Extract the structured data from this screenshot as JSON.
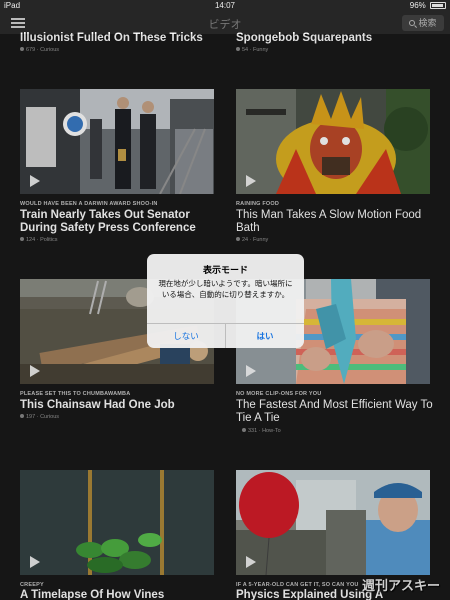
{
  "status_bar": {
    "device": "iPad",
    "time": "14:07",
    "battery": "96%"
  },
  "nav": {
    "title": "ビデオ",
    "search_label": "検索"
  },
  "top_row": [
    {
      "title": "Illusionist Fulled On These Tricks",
      "meta": "679 · Curious"
    },
    {
      "title": "Spongebob Squarepants",
      "meta": "54 · Funny"
    }
  ],
  "cards": [
    {
      "kicker": "WOULD HAVE BEEN A DARWIN AWARD SHOO-IN",
      "title": "Train Nearly Takes Out Senator During Safety Press Conference",
      "meta": "124 · Politics"
    },
    {
      "kicker": "RAINING FOOD",
      "title": "This Man Takes A Slow Motion Food Bath",
      "meta": "24 · Funny"
    },
    {
      "kicker": "PLEASE SET THIS TO CHUMBAWAMBA",
      "title": "This Chainsaw Had One Job",
      "meta": "197 · Curious"
    },
    {
      "kicker": "NO MORE CLIP-ONS FOR YOU",
      "title": "The Fastest And Most Efficient Way To Tie A Tie",
      "meta": "331 · How-To"
    },
    {
      "kicker": "CREEPY",
      "title": "A Timelapse Of How Vines",
      "meta": ""
    },
    {
      "kicker": "IF A 5-YEAR-OLD CAN GET IT, SO CAN YOU",
      "title": "Physics Explained Using A",
      "meta": ""
    }
  ],
  "dialog": {
    "title": "表示モード",
    "message": "現在地が少し暗いようです。暗い場所にいる場合、自動的に切り替えますか。",
    "cancel_label": "しない",
    "confirm_label": "はい"
  },
  "watermark": "週刊アスキー"
}
